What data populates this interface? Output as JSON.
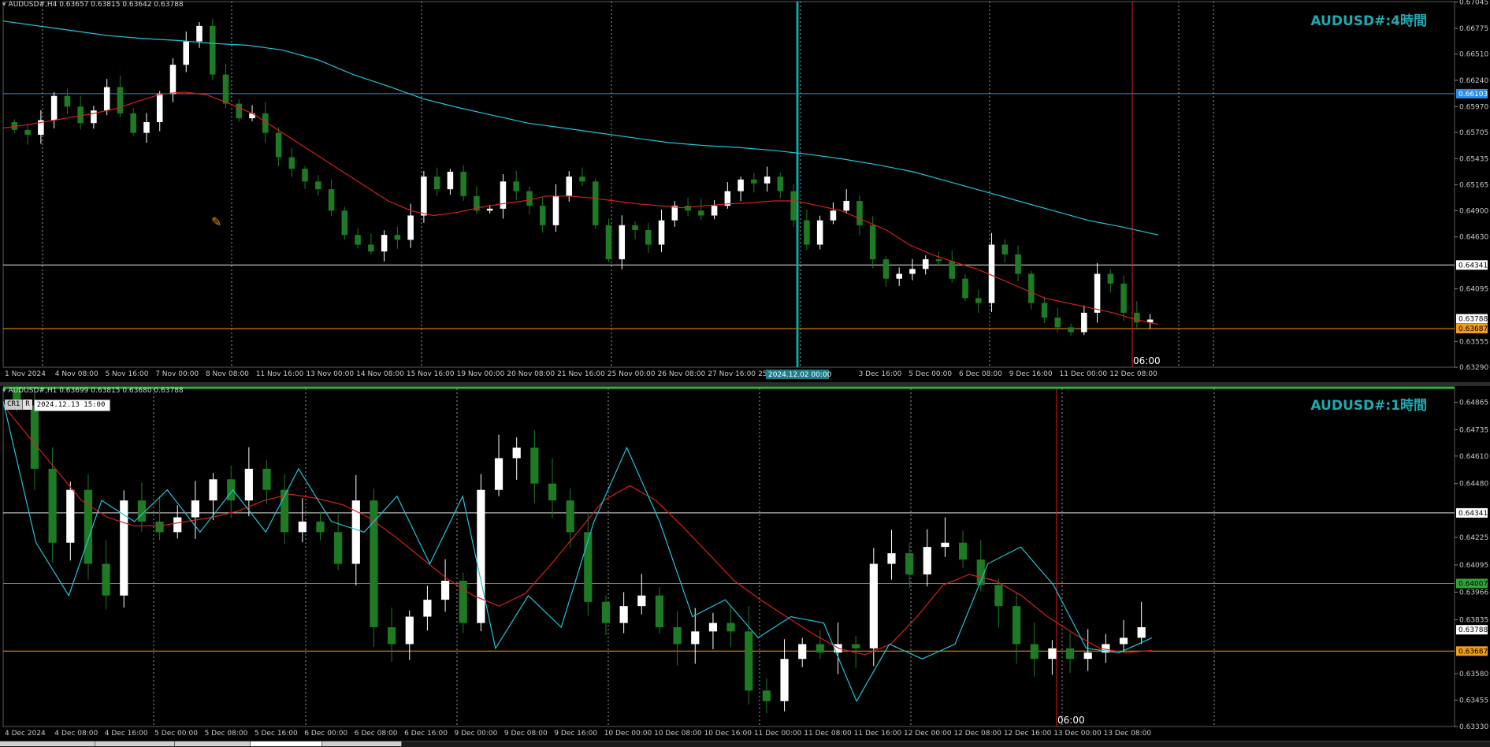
{
  "colors": {
    "background": "#000000",
    "grid": "#9a9a9a",
    "bull": "#ffffff",
    "bear": "#1f7a24",
    "ma_slow": "#1fc4d8",
    "ma_fast": "#d81e1e",
    "zigzag": "#f4a01a",
    "hline_blue": "#2c8be6",
    "hline_white": "#e8e8e8",
    "hline_orange": "#f29d13",
    "hline_green": "#2fa63a",
    "vline_red": "#e01818",
    "vline_teal": "#14a3a3",
    "axis_text": "#c8c8c8"
  },
  "top": {
    "header": "AUDUSD#,H4  0.63657 0.63815 0.63642 0.63788",
    "watermark": "AUDUSD#:4時間",
    "time_label": "06:00",
    "sel_date": "2024.12.02 00:00",
    "price_ticks": [
      "0.67045",
      "0.66775",
      "0.66510",
      "0.66240",
      "0.65970",
      "0.65705",
      "0.65435",
      "0.65165",
      "0.64900",
      "0.64630",
      "0.64095",
      "0.63555",
      "0.63290"
    ],
    "price_badges": [
      {
        "text": "0.66103",
        "color": "#2c8be6",
        "text_color": "#ffffff"
      },
      {
        "text": "0.64341",
        "color": "#ffffff",
        "text_color": "#000000"
      },
      {
        "text": "0.63788",
        "color": "#ffffff",
        "text_color": "#000000"
      },
      {
        "text": "0.63687",
        "color": "#f29d13",
        "text_color": "#000000"
      }
    ],
    "time_ticks": [
      "1 Nov 2024",
      "4 Nov 08:00",
      "5 Nov 16:00",
      "7 Nov 00:00",
      "8 Nov 08:00",
      "11 Nov 16:00",
      "13 Nov 00:00",
      "14 Nov 08:00",
      "15 Nov 16:00",
      "19 Nov 00:00",
      "20 Nov 08:00",
      "21 Nov 16:00",
      "25 Nov 00:00",
      "26 Nov 08:00",
      "27 Nov 16:00",
      "25",
      "08:00",
      "3 Dec 16:00",
      "5 Dec 00:00",
      "6 Dec 08:00",
      "9 Dec 16:00",
      "11 Dec 00:00",
      "12 Dec 08:00"
    ]
  },
  "bottom": {
    "header": "AUDUSD#,H1  0.63699 0.63815 0.63680 0.63788",
    "watermark": "AUDUSD#:1時間",
    "time_label": "06:00",
    "crosshair": {
      "tag1": "CR1",
      "tag2": "R",
      "datetime": "2024.12.13 15:00"
    },
    "price_ticks": [
      "0.64865",
      "0.64735",
      "0.64610",
      "0.64480",
      "0.64225",
      "0.64095",
      "0.63966",
      "0.63835",
      "0.63580",
      "0.63455",
      "0.63330"
    ],
    "price_badges": [
      {
        "text": "0.64341",
        "color": "#ffffff",
        "text_color": "#000000"
      },
      {
        "text": "0.64007",
        "color": "#2fa63a",
        "text_color": "#000000"
      },
      {
        "text": "0.63788",
        "color": "#ffffff",
        "text_color": "#000000"
      },
      {
        "text": "0.63687",
        "color": "#f29d13",
        "text_color": "#000000"
      }
    ],
    "time_ticks": [
      "4 Dec 2024",
      "4 Dec 08:00",
      "4 Dec 16:00",
      "5 Dec 00:00",
      "5 Dec 08:00",
      "5 Dec 16:00",
      "6 Dec 00:00",
      "6 Dec 08:00",
      "6 Dec 16:00",
      "9 Dec 00:00",
      "9 Dec 08:00",
      "9 Dec 16:00",
      "10 Dec 00:00",
      "10 Dec 08:00",
      "10 Dec 16:00",
      "11 Dec 00:00",
      "11 Dec 08:00",
      "11 Dec 16:00",
      "12 Dec 00:00",
      "12 Dec 08:00",
      "12 Dec 16:00",
      "13 Dec 00:00",
      "13 Dec 08:00"
    ]
  },
  "chart_data": [
    {
      "type": "line",
      "title": "AUDUSD#:4時間",
      "ylim": [
        0.6329,
        0.6705
      ],
      "grid": true,
      "series": [
        {
          "values": [
            0.6573,
            0.6568,
            0.6583,
            0.6608,
            0.6597,
            0.658,
            0.6593,
            0.6617,
            0.659,
            0.657,
            0.6581,
            0.661,
            0.664,
            0.6664,
            0.668,
            0.663,
            0.66,
            0.6585,
            0.659,
            0.657,
            0.6545,
            0.6533,
            0.652,
            0.6512,
            0.649,
            0.6465,
            0.6455,
            0.6448,
            0.6465,
            0.646,
            0.6485,
            0.6525,
            0.6512,
            0.653,
            0.6505,
            0.649,
            0.6492,
            0.652,
            0.651,
            0.6495,
            0.6475,
            0.6505,
            0.6525,
            0.652,
            0.6475,
            0.644,
            0.6475,
            0.647,
            0.6455,
            0.648,
            0.6495,
            0.649,
            0.6485,
            0.6495,
            0.651,
            0.6522,
            0.6518,
            0.6525,
            0.651,
            0.648,
            0.6455,
            0.648,
            0.649,
            0.65,
            0.6475,
            0.644,
            0.642,
            0.6425,
            0.643,
            0.644,
            0.6438,
            0.642,
            0.64,
            0.6395,
            0.6455,
            0.6445,
            0.6425,
            0.6395,
            0.638,
            0.637,
            0.6365,
            0.6385,
            0.6425,
            0.6415,
            0.6385,
            0.6375,
            0.6378
          ]
        },
        {
          "values": [
            0.6575,
            0.6578,
            0.6582,
            0.6586,
            0.659,
            0.6595,
            0.6603,
            0.661,
            0.6612,
            0.6609,
            0.66,
            0.659,
            0.6575,
            0.656,
            0.6545,
            0.653,
            0.6515,
            0.65,
            0.649,
            0.6485,
            0.6488,
            0.6493,
            0.6497,
            0.65,
            0.6505,
            0.6505,
            0.6503,
            0.65,
            0.6497,
            0.6495,
            0.6493,
            0.6495,
            0.6497,
            0.6498,
            0.65,
            0.65,
            0.6495,
            0.649,
            0.648,
            0.647,
            0.6455,
            0.6445,
            0.6437,
            0.643,
            0.642,
            0.641,
            0.64,
            0.6395,
            0.639,
            0.6385,
            0.6378,
            0.6373
          ]
        },
        {
          "values": [
            0.6685,
            0.668,
            0.6675,
            0.667,
            0.6667,
            0.6665,
            0.6662,
            0.666,
            0.6655,
            0.6645,
            0.663,
            0.6618,
            0.6605,
            0.6596,
            0.6588,
            0.658,
            0.6575,
            0.657,
            0.6565,
            0.656,
            0.6557,
            0.6555,
            0.6552,
            0.6548,
            0.6543,
            0.6537,
            0.653,
            0.652,
            0.651,
            0.65,
            0.649,
            0.648,
            0.6473,
            0.6465
          ]
        }
      ]
    },
    {
      "type": "line",
      "title": "AUDUSD#:1時間",
      "ylim": [
        0.6333,
        0.6493
      ],
      "grid": true,
      "series": [
        {
          "values": [
            0.6485,
            0.6455,
            0.642,
            0.6445,
            0.641,
            0.6395,
            0.644,
            0.643,
            0.6425,
            0.6432,
            0.644,
            0.645,
            0.644,
            0.6455,
            0.6445,
            0.6425,
            0.643,
            0.6425,
            0.641,
            0.644,
            0.638,
            0.6372,
            0.6385,
            0.6393,
            0.6402,
            0.6382,
            0.6445,
            0.646,
            0.6465,
            0.6448,
            0.644,
            0.6425,
            0.6392,
            0.6382,
            0.639,
            0.6395,
            0.638,
            0.6372,
            0.6378,
            0.6382,
            0.6378,
            0.635,
            0.6345,
            0.6365,
            0.6372,
            0.6368,
            0.6372,
            0.637,
            0.641,
            0.6415,
            0.6405,
            0.6418,
            0.642,
            0.6412,
            0.64,
            0.639,
            0.6372,
            0.6365,
            0.637,
            0.6365,
            0.6368,
            0.6372,
            0.6375,
            0.638
          ]
        },
        {
          "values": [
            0.6485,
            0.647,
            0.6455,
            0.644,
            0.6432,
            0.6428,
            0.6428,
            0.643,
            0.6432,
            0.6435,
            0.644,
            0.6443,
            0.6441,
            0.6438,
            0.6432,
            0.6423,
            0.6413,
            0.6403,
            0.6395,
            0.639,
            0.6396,
            0.641,
            0.6425,
            0.644,
            0.6447,
            0.644,
            0.6428,
            0.6415,
            0.6402,
            0.6393,
            0.6385,
            0.6377,
            0.637,
            0.6367,
            0.6372,
            0.6385,
            0.64,
            0.6405,
            0.6402,
            0.6395,
            0.6385,
            0.6377,
            0.637,
            0.6368,
            0.6369
          ]
        },
        {
          "values": [
            0.6487,
            0.642,
            0.6395,
            0.644,
            0.643,
            0.6445,
            0.6425,
            0.6445,
            0.6425,
            0.6455,
            0.643,
            0.6425,
            0.6442,
            0.641,
            0.6442,
            0.637,
            0.6395,
            0.638,
            0.643,
            0.6465,
            0.643,
            0.6385,
            0.6393,
            0.6375,
            0.6385,
            0.6382,
            0.6345,
            0.6372,
            0.6365,
            0.6372,
            0.641,
            0.6418,
            0.64,
            0.637,
            0.6368,
            0.6375
          ]
        }
      ]
    }
  ]
}
